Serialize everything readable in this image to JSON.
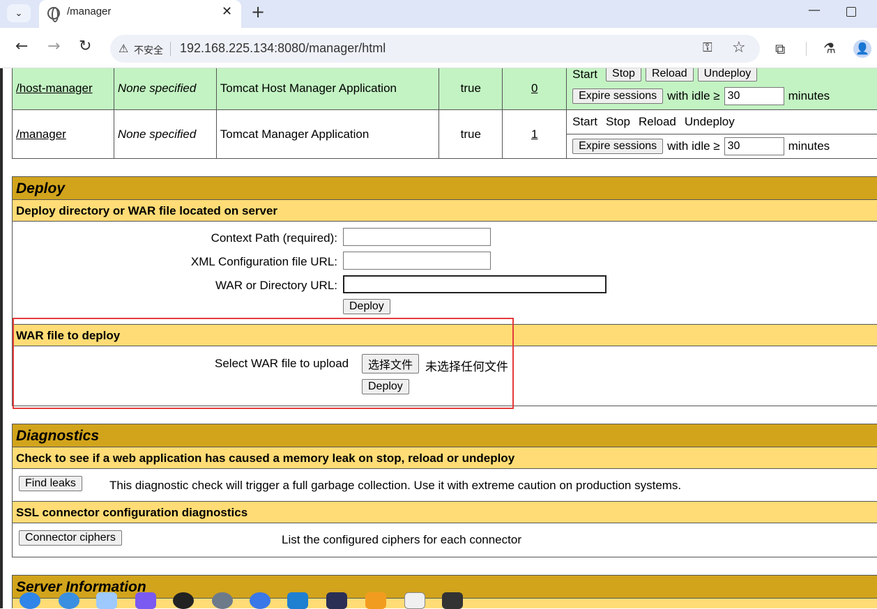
{
  "browser": {
    "tab_title": "/manager",
    "insecure_label": "不安全",
    "url": "192.168.225.134:8080/manager/html"
  },
  "applications": {
    "rows": [
      {
        "path": "/host-manager",
        "version": "None specified",
        "display_name": "Tomcat Host Manager Application",
        "running": "true",
        "sessions": "0",
        "commands": [
          "Start",
          "Stop",
          "Reload",
          "Undeploy"
        ],
        "expire_label": "Expire sessions",
        "with_idle": "with idle ≥",
        "idle_value": "30",
        "minutes": "minutes"
      },
      {
        "path": "/manager",
        "version": "None specified",
        "display_name": "Tomcat Manager Application",
        "running": "true",
        "sessions": "1",
        "commands": [
          "Start",
          "Stop",
          "Reload",
          "Undeploy"
        ],
        "expire_label": "Expire sessions",
        "with_idle": "with idle ≥",
        "idle_value": "30",
        "minutes": "minutes"
      }
    ]
  },
  "deploy": {
    "title": "Deploy",
    "server_subtitle": "Deploy directory or WAR file located on server",
    "context_path_label": "Context Path (required):",
    "xml_config_label": "XML Configuration file URL:",
    "war_dir_label": "WAR or Directory URL:",
    "deploy_button": "Deploy",
    "war_subtitle": "WAR file to deploy",
    "select_war_label": "Select WAR file to upload",
    "choose_file_button": "选择文件",
    "no_file_label": "未选择任何文件",
    "war_deploy_button": "Deploy"
  },
  "diagnostics": {
    "title": "Diagnostics",
    "leak_subtitle": "Check to see if a web application has caused a memory leak on stop, reload or undeploy",
    "find_leaks_button": "Find leaks",
    "find_leaks_desc": "This diagnostic check will trigger a full garbage collection. Use it with extreme caution on production systems.",
    "ssl_subtitle": "SSL connector configuration diagnostics",
    "ciphers_button": "Connector ciphers",
    "ciphers_desc": "List the configured ciphers for each connector"
  },
  "server_info": {
    "title": "Server Information"
  },
  "colors": {
    "section_title": "#d2a41c",
    "subsection": "#ffdc75",
    "running_row": "#c3f3c3",
    "highlight_box": "#e43b3b"
  }
}
